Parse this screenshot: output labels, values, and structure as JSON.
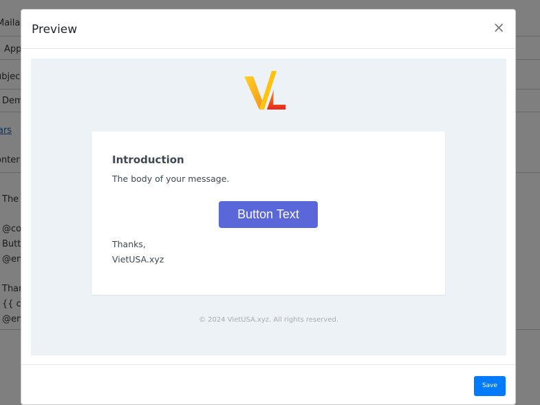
{
  "background": {
    "fragments": [
      "Mailab",
      "App",
      "ubjec",
      "Dem",
      "ars",
      "onter",
      "The",
      "@co",
      "Butt",
      "@en",
      "Than",
      "{{ co",
      "@en"
    ]
  },
  "modal": {
    "title": "Preview",
    "close_glyph": "×"
  },
  "email": {
    "heading": "Introduction",
    "body": "The body of your message.",
    "button_label": "Button Text",
    "thanks": "Thanks,",
    "signature": "VietUSA.xyz",
    "copyright": "© 2024 VietUSA.xyz. All rights reserved.",
    "logo_icon": "vl-logo-icon"
  },
  "footer": {
    "save_label": "Save"
  },
  "colors": {
    "button": "#5a67d8",
    "save": "#007bff",
    "body_bg": "#edf2f7"
  }
}
